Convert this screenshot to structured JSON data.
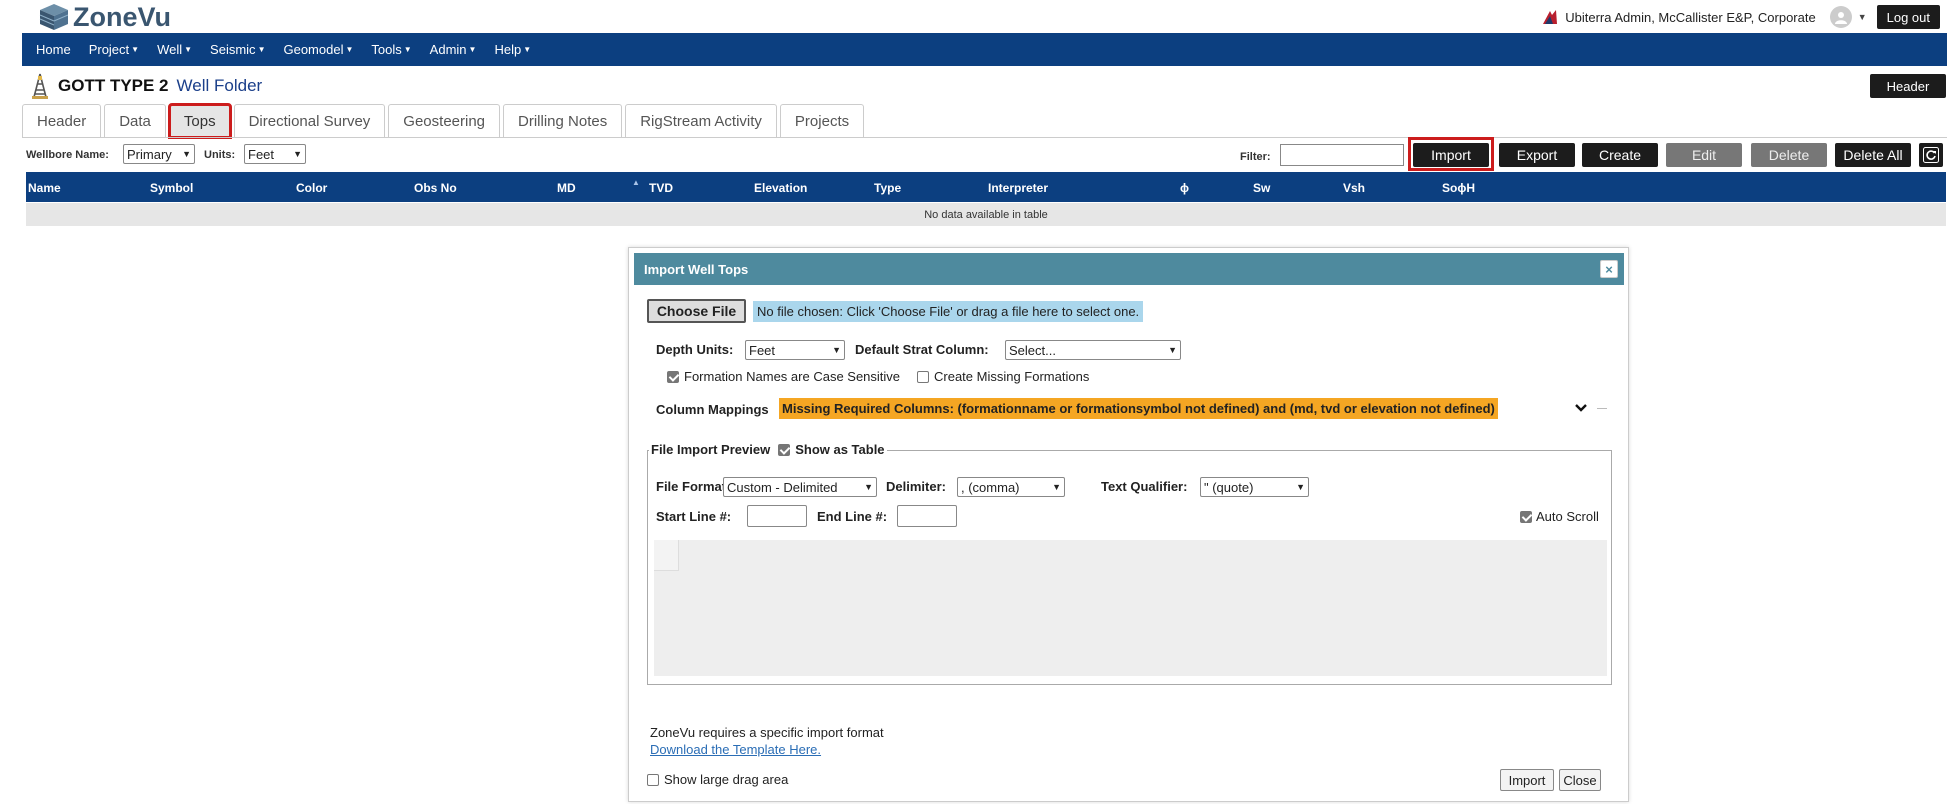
{
  "app": {
    "logo_text": "ZoneVu"
  },
  "user": {
    "display": "Ubiterra Admin, McCallister E&P, Corporate",
    "logout_label": "Log out"
  },
  "nav": [
    "Home",
    "Project",
    "Well",
    "Seismic",
    "Geomodel",
    "Tools",
    "Admin",
    "Help"
  ],
  "nav_has_caret": [
    false,
    true,
    true,
    true,
    true,
    true,
    true,
    true
  ],
  "well": {
    "name": "GOTT TYPE 2",
    "folder": "Well Folder",
    "header_button": "Header"
  },
  "tabs": [
    "Header",
    "Data",
    "Tops",
    "Directional Survey",
    "Geosteering",
    "Drilling Notes",
    "RigStream Activity",
    "Projects"
  ],
  "active_tab": "Tops",
  "toolbar": {
    "wellbore_label": "Wellbore Name:",
    "wellbore_value": "Primary",
    "units_label": "Units:",
    "units_value": "Feet",
    "filter_label": "Filter:",
    "filter_value": "",
    "import_label": "Import",
    "export_label": "Export",
    "create_label": "Create",
    "edit_label": "Edit",
    "delete_label": "Delete",
    "delete_all_label": "Delete All",
    "refresh_icon": "refresh-icon"
  },
  "table": {
    "columns": [
      "Name",
      "Symbol",
      "Color",
      "Obs No",
      "MD",
      "TVD",
      "Elevation",
      "Type",
      "Interpreter",
      "ϕ",
      "Sw",
      "Vsh",
      "SoϕH"
    ],
    "sort_column": "TVD",
    "empty_message": "No data available in table"
  },
  "modal": {
    "title": "Import Well Tops",
    "close_glyph": "×",
    "choose_file_label": "Choose File",
    "file_hint": "No file chosen: Click 'Choose File' or drag a file here to select one.",
    "depth_units_label": "Depth Units:",
    "depth_units_value": "Feet",
    "strat_label": "Default Strat Column:",
    "strat_value": "Select...",
    "case_sensitive_label": "Formation Names are Case Sensitive",
    "case_sensitive_checked": true,
    "create_missing_label": "Create Missing Formations",
    "create_missing_checked": false,
    "mappings_label": "Column Mappings",
    "mappings_warning": "Missing Required Columns: (formationname or formationsymbol not defined) and (md, tvd or elevation not defined)",
    "preview_label": "File Import Preview",
    "show_as_table_label": "Show as Table",
    "show_as_table_checked": true,
    "file_format_label": "File Format:",
    "file_format_value": "Custom - Delimited",
    "delimiter_label": "Delimiter:",
    "delimiter_value": ", (comma)",
    "qualifier_label": "Text Qualifier:",
    "qualifier_value": "\" (quote)",
    "start_line_label": "Start Line #:",
    "start_line_value": "",
    "end_line_label": "End Line #:",
    "end_line_value": "",
    "auto_scroll_label": "Auto Scroll",
    "auto_scroll_checked": true,
    "requirement_text": "ZoneVu requires a specific import format",
    "template_link": "Download the Template Here.",
    "large_drag_label": "Show large drag area",
    "large_drag_checked": false,
    "import_button": "Import",
    "close_button": "Close"
  },
  "colors": {
    "nav_bg": "#0c3f80",
    "modal_header": "#4e8a9e",
    "warning": "#f5a623",
    "highlight": "#cc1c1c",
    "file_hint_bg": "#aad6ec"
  }
}
